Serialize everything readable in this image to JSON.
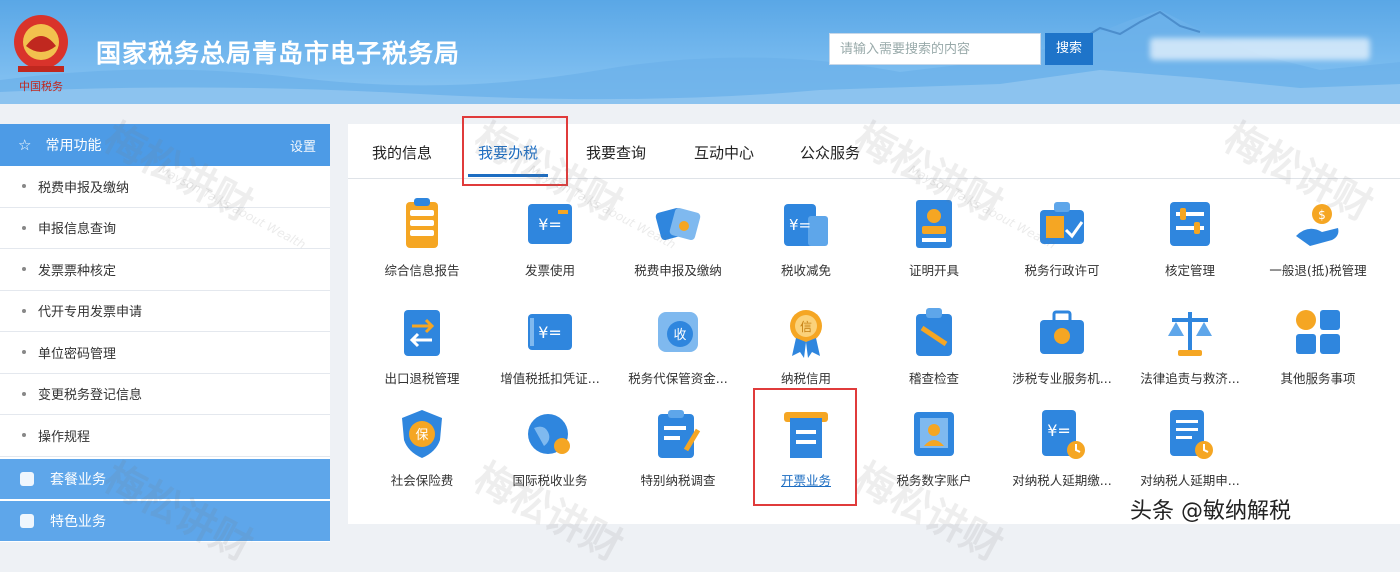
{
  "header": {
    "site_title": "国家税务总局青岛市电子税务局",
    "logo_text": "中国税务",
    "search_placeholder": "请输入需要搜索的内容",
    "search_button": "搜索"
  },
  "sidebar": {
    "common_title": "常用功能",
    "settings_label": "设置",
    "items": [
      "税费申报及缴纳",
      "申报信息查询",
      "发票票种核定",
      "代开专用发票申请",
      "单位密码管理",
      "变更税务登记信息",
      "操作规程"
    ],
    "groups": [
      "套餐业务",
      "特色业务"
    ]
  },
  "tabs": [
    "我的信息",
    "我要办税",
    "我要查询",
    "互动中心",
    "公众服务"
  ],
  "active_tab": "我要办税",
  "tiles": {
    "row1": [
      "综合信息报告",
      "发票使用",
      "税费申报及缴纳",
      "税收减免",
      "证明开具",
      "税务行政许可",
      "核定管理",
      "一般退(抵)税管理"
    ],
    "row2": [
      "出口退税管理",
      "增值税抵扣凭证...",
      "税务代保管资金...",
      "纳税信用",
      "稽查检查",
      "涉税专业服务机...",
      "法律追责与救济...",
      "其他服务事项"
    ],
    "row3": [
      "社会保险费",
      "国际税收业务",
      "特别纳税调查",
      "开票业务",
      "税务数字账户",
      "对纳税人延期缴...",
      "对纳税人延期申..."
    ]
  },
  "icons": {
    "row1": [
      "doc-stack-icon",
      "invoice-icon",
      "tax-payment-icon",
      "tax-relief-icon",
      "certificate-icon",
      "admin-license-icon",
      "assessment-icon",
      "refund-icon"
    ],
    "row2": [
      "export-refund-icon",
      "vat-voucher-icon",
      "custody-fund-icon",
      "credit-medal-icon",
      "inspection-icon",
      "professional-service-icon",
      "justice-scale-icon",
      "other-services-icon"
    ],
    "row3": [
      "social-insurance-icon",
      "international-tax-icon",
      "special-investigation-icon",
      "invoice-issue-icon",
      "digital-account-icon",
      "deferred-payment-icon",
      "deferred-filing-icon"
    ]
  },
  "watermark": {
    "text": "梅松讲财",
    "sub": "Mayson Talks about Wealth"
  },
  "credit": "头条 @敏纳解税",
  "colors": {
    "primary": "#1c6dc2",
    "sidebar_blue": "#4d9be6",
    "highlight_red": "#e03b3b",
    "icon_blue": "#2f86de",
    "icon_orange": "#f5a623"
  }
}
